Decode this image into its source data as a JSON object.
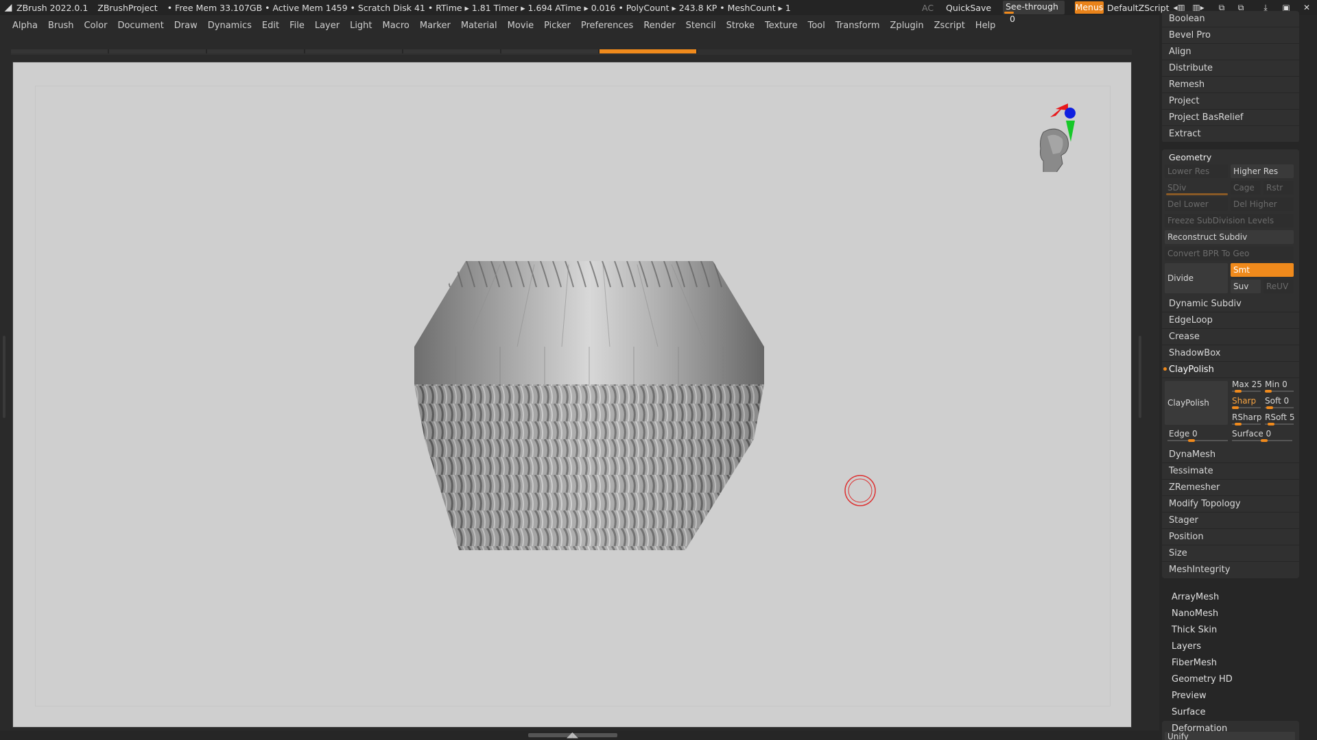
{
  "titlebar": {
    "app": "ZBrush 2022.0.1",
    "project": "ZBrushProject",
    "stats": "• Free Mem 33.107GB • Active Mem 1459 • Scratch Disk 41 • RTime ▸ 1.81 Timer ▸ 1.694 ATime ▸ 0.016 • PolyCount ▸ 243.8 KP • MeshCount ▸ 1",
    "ac": "AC",
    "quicksave": "QuickSave",
    "seethrough": "See-through",
    "seethrough_value": "0",
    "menus": "Menus",
    "script": "DefaultZScript"
  },
  "menubar": [
    "Alpha",
    "Brush",
    "Color",
    "Document",
    "Draw",
    "Dynamics",
    "Edit",
    "File",
    "Layer",
    "Light",
    "Macro",
    "Marker",
    "Material",
    "Movie",
    "Picker",
    "Preferences",
    "Render",
    "Stencil",
    "Stroke",
    "Texture",
    "Tool",
    "Transform",
    "Zplugin",
    "Zscript",
    "Help"
  ],
  "panel": {
    "top_items": [
      "Boolean",
      "Bevel Pro",
      "Align",
      "Distribute",
      "Remesh",
      "Project",
      "Project BasRelief",
      "Extract"
    ],
    "geometry": {
      "title": "Geometry",
      "lower_res": "Lower Res",
      "higher_res": "Higher Res",
      "sdiv": "SDiv",
      "cage": "Cage",
      "rstr": "Rstr",
      "del_lower": "Del Lower",
      "del_higher": "Del Higher",
      "freeze": "Freeze SubDivision Levels",
      "reconstruct": "Reconstruct Subdiv",
      "convert": "Convert BPR To Geo",
      "divide": "Divide",
      "smt": "Smt",
      "suv": "Suv",
      "reuv": "ReUV",
      "dynamic_subdiv": "Dynamic Subdiv",
      "edgeloop": "EdgeLoop",
      "crease": "Crease",
      "shadowbox": "ShadowBox",
      "claypolish_header": "ClayPolish",
      "claypolish_btn": "ClayPolish",
      "max": "Max 25",
      "min": "Min 0",
      "sharp": "Sharp",
      "soft": "Soft 0",
      "rsharp": "RSharp",
      "rsoft": "RSoft 5",
      "edge": "Edge 0",
      "surface": "Surface 0",
      "items_after": [
        "DynaMesh",
        "Tessimate",
        "ZRemesher",
        "Modify Topology",
        "Stager",
        "Position",
        "Size",
        "MeshIntegrity"
      ]
    },
    "subpalettes": [
      "ArrayMesh",
      "NanoMesh",
      "Thick Skin",
      "Layers",
      "FiberMesh",
      "Geometry HD",
      "Preview",
      "Surface",
      "Deformation"
    ],
    "bottom_partial": "Unify"
  }
}
